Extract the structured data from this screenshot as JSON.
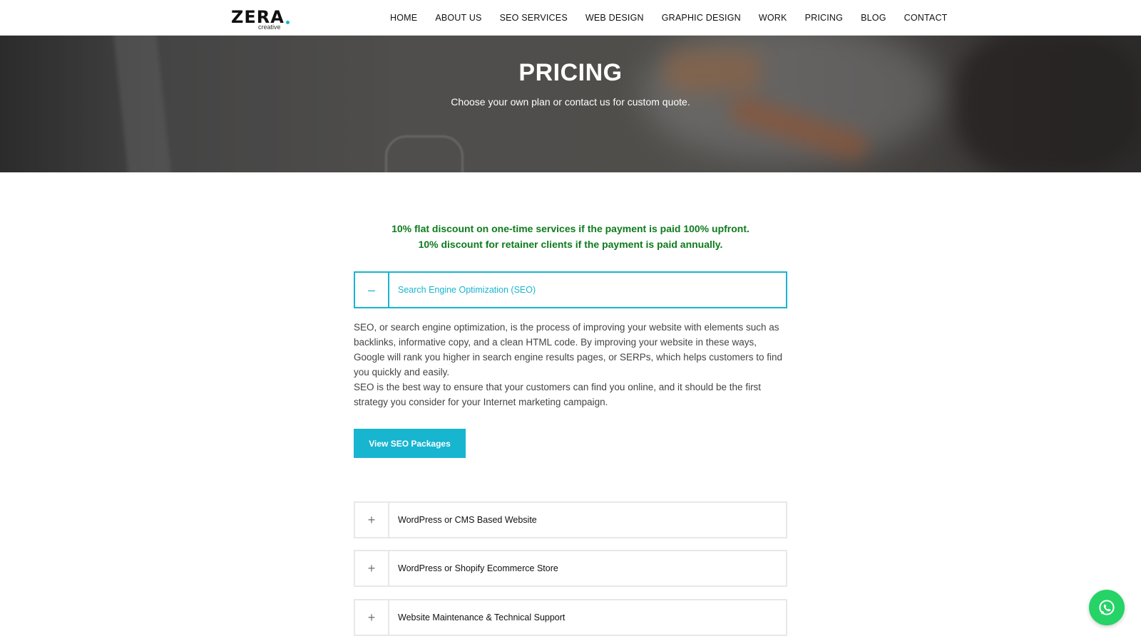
{
  "logo": {
    "main": "ZERA",
    "sub": "creative"
  },
  "nav": [
    {
      "label": "HOME"
    },
    {
      "label": "ABOUT US"
    },
    {
      "label": "SEO SERVICES"
    },
    {
      "label": "WEB DESIGN"
    },
    {
      "label": "GRAPHIC DESIGN"
    },
    {
      "label": "WORK"
    },
    {
      "label": "PRICING"
    },
    {
      "label": "BLOG"
    },
    {
      "label": "CONTACT"
    }
  ],
  "hero": {
    "title": "PRICING",
    "subtitle": "Choose your own plan or contact us for custom quote."
  },
  "discounts": [
    "10% flat discount on one-time services if the payment is paid 100% upfront.",
    "10% discount for retainer clients if the payment is paid annually."
  ],
  "accordion": [
    {
      "title": "Search Engine Optimization (SEO)",
      "toggle": "–",
      "expanded": true,
      "body": [
        "SEO, or search engine optimization, is the process of improving your website with elements such as backlinks, informative copy, and a clean HTML code. By improving your website in these ways, Google will rank you higher in search engine results pages, or SERPs, which helps customers to find you quickly and easily.",
        "SEO is the best way to ensure that your customers can find you online, and it should be the first strategy you consider for your Internet marketing campaign."
      ],
      "button": "View SEO Packages"
    },
    {
      "title": "WordPress or CMS Based Website",
      "toggle": "+",
      "expanded": false
    },
    {
      "title": "WordPress or Shopify Ecommerce Store",
      "toggle": "+",
      "expanded": false
    },
    {
      "title": "Website Maintenance & Technical Support",
      "toggle": "+",
      "expanded": false
    }
  ],
  "colors": {
    "accent": "#18b5d0",
    "discount_text": "#0e7b1c",
    "whatsapp": "#25d366"
  },
  "icons": {
    "whatsapp": "whatsapp-icon"
  }
}
